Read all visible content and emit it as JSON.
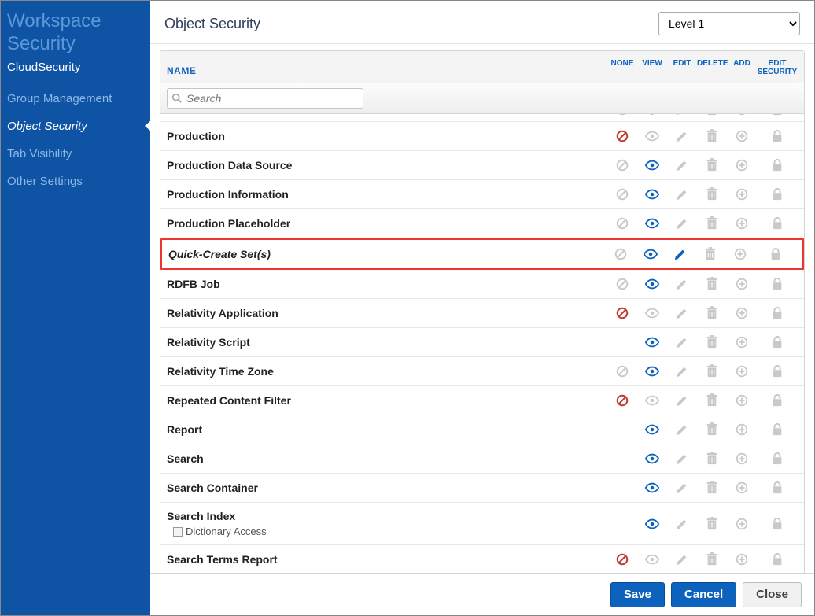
{
  "sidebar": {
    "title": "Workspace Security",
    "subtitle": "CloudSecurity",
    "items": [
      {
        "label": "Group Management",
        "active": false
      },
      {
        "label": "Object Security",
        "active": true
      },
      {
        "label": "Tab Visibility",
        "active": false
      },
      {
        "label": "Other Settings",
        "active": false
      }
    ]
  },
  "header": {
    "title": "Object Security",
    "level_selected": "Level 1"
  },
  "columns": {
    "name": "NAME",
    "none": "NONE",
    "view": "VIEW",
    "edit": "EDIT",
    "delete": "DELETE",
    "add": "ADD",
    "edit_security": "EDIT SECURITY"
  },
  "search": {
    "placeholder": "Search"
  },
  "rows": [
    {
      "name": "Production",
      "none": "on-red",
      "view": "off",
      "edit": "off",
      "delete": "off",
      "add": "off",
      "editsec": "off",
      "highlight": false
    },
    {
      "name": "Production Data Source",
      "none": "off",
      "view": "on",
      "edit": "off",
      "delete": "off",
      "add": "off",
      "editsec": "off",
      "highlight": false
    },
    {
      "name": "Production Information",
      "none": "off",
      "view": "on",
      "edit": "off",
      "delete": "off",
      "add": "off",
      "editsec": "off",
      "highlight": false
    },
    {
      "name": "Production Placeholder",
      "none": "off",
      "view": "on",
      "edit": "off",
      "delete": "off",
      "add": "off",
      "editsec": "off",
      "highlight": false
    },
    {
      "name": "Quick-Create Set(s)",
      "none": "off",
      "view": "on",
      "edit": "on",
      "delete": "off",
      "add": "off",
      "editsec": "off",
      "highlight": true
    },
    {
      "name": "RDFB Job",
      "none": "off",
      "view": "on",
      "edit": "off",
      "delete": "off",
      "add": "off",
      "editsec": "off",
      "highlight": false
    },
    {
      "name": "Relativity Application",
      "none": "on-red",
      "view": "off",
      "edit": "off",
      "delete": "off",
      "add": "off",
      "editsec": "off",
      "highlight": false
    },
    {
      "name": "Relativity Script",
      "none": "hidden",
      "view": "on",
      "edit": "off",
      "delete": "off",
      "add": "off",
      "editsec": "off",
      "highlight": false
    },
    {
      "name": "Relativity Time Zone",
      "none": "off",
      "view": "on",
      "edit": "off",
      "delete": "off",
      "add": "off",
      "editsec": "off",
      "highlight": false
    },
    {
      "name": "Repeated Content Filter",
      "none": "on-red",
      "view": "off",
      "edit": "off",
      "delete": "off",
      "add": "off",
      "editsec": "off",
      "highlight": false
    },
    {
      "name": "Report",
      "none": "hidden",
      "view": "on",
      "edit": "off",
      "delete": "off",
      "add": "off",
      "editsec": "off",
      "highlight": false
    },
    {
      "name": "Search",
      "none": "hidden",
      "view": "on",
      "edit": "off",
      "delete": "off",
      "add": "off",
      "editsec": "off",
      "highlight": false
    },
    {
      "name": "Search Container",
      "none": "hidden",
      "view": "on",
      "edit": "off",
      "delete": "off",
      "add": "off",
      "editsec": "off",
      "highlight": false
    },
    {
      "name": "Search Index",
      "none": "hidden",
      "view": "on",
      "edit": "off",
      "delete": "off",
      "add": "off",
      "editsec": "off",
      "highlight": false,
      "subitems": [
        "Dictionary Access"
      ]
    },
    {
      "name": "Search Terms Report",
      "none": "on-red",
      "view": "off",
      "edit": "off",
      "delete": "off",
      "add": "off",
      "editsec": "off",
      "highlight": false
    }
  ],
  "footer": {
    "save": "Save",
    "cancel": "Cancel",
    "close": "Close"
  },
  "colors": {
    "active_blue": "#0d62bd",
    "denied_red": "#c0392b",
    "off_grey": "#c9c9c9"
  }
}
